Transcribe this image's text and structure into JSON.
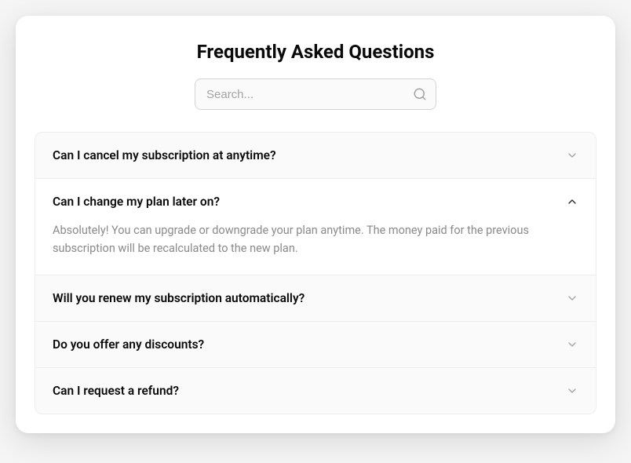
{
  "title": "Frequently Asked Questions",
  "search": {
    "placeholder": "Search..."
  },
  "faqs": [
    {
      "question": "Can I cancel my subscription at anytime?",
      "expanded": false
    },
    {
      "question": "Can I change my plan later on?",
      "answer": "Absolutely! You can upgrade or downgrade your plan anytime. The money paid for the previous subscription will be recalculated to the new plan.",
      "expanded": true
    },
    {
      "question": "Will you renew my subscription automatically?",
      "expanded": false
    },
    {
      "question": "Do you offer any discounts?",
      "expanded": false
    },
    {
      "question": "Can I request a refund?",
      "expanded": false
    }
  ]
}
